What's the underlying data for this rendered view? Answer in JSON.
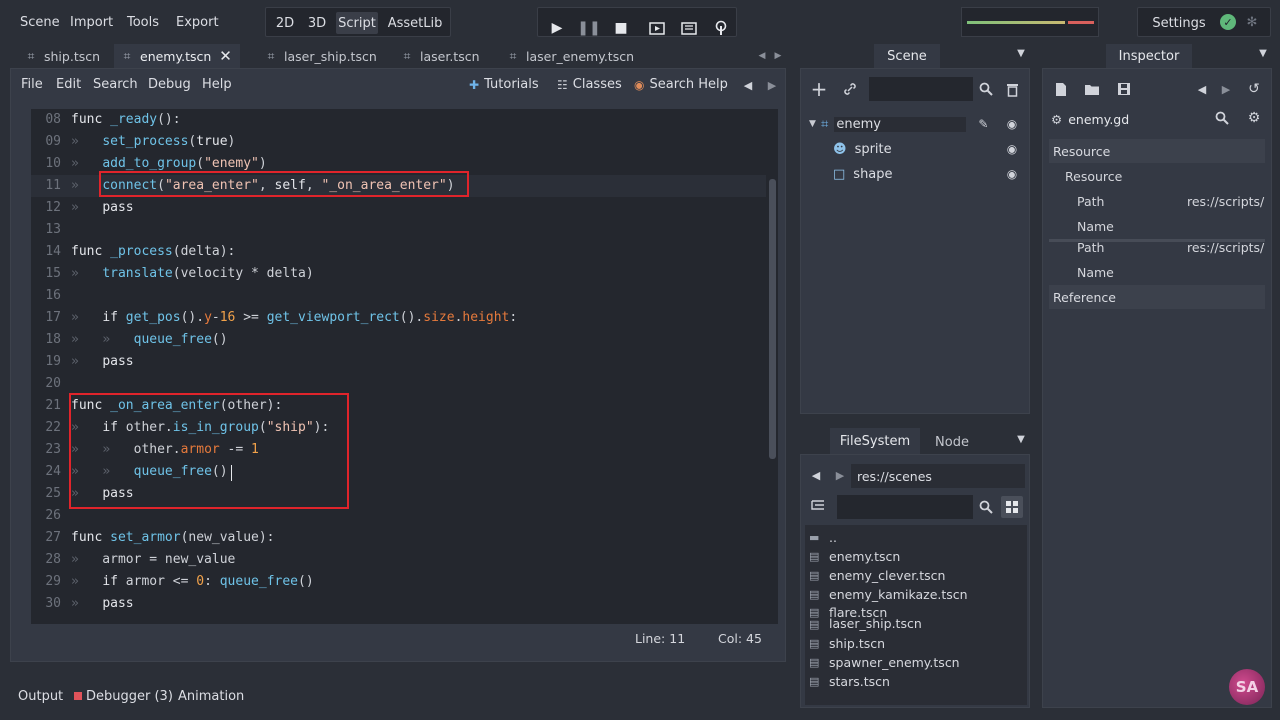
{
  "topbar": {
    "menus": [
      "Scene",
      "Import",
      "Tools",
      "Export"
    ],
    "modes": [
      "2D",
      "3D",
      "Script",
      "AssetLib"
    ],
    "active_mode": "Script",
    "settings_label": "Settings"
  },
  "tabs": [
    {
      "label": "ship.tscn"
    },
    {
      "label": "enemy.tscn",
      "active": true
    },
    {
      "label": "laser_ship.tscn"
    },
    {
      "label": "laser.tscn"
    },
    {
      "label": "laser_enemy.tscn"
    }
  ],
  "editor": {
    "menus": [
      "File",
      "Edit",
      "Search",
      "Debug",
      "Help"
    ],
    "tutorials_label": "Tutorials",
    "classes_label": "Classes",
    "search_help_label": "Search Help",
    "lines": [
      {
        "n": "08",
        "text": "func _ready():"
      },
      {
        "n": "09",
        "text": "  set_process(true)"
      },
      {
        "n": "10",
        "text": "  add_to_group(\"enemy\")"
      },
      {
        "n": "11",
        "text": "  connect(\"area_enter\", self, \"_on_area_enter\")"
      },
      {
        "n": "12",
        "text": "  pass"
      },
      {
        "n": "13",
        "text": ""
      },
      {
        "n": "14",
        "text": "func _process(delta):"
      },
      {
        "n": "15",
        "text": "  translate(velocity * delta)"
      },
      {
        "n": "16",
        "text": ""
      },
      {
        "n": "17",
        "text": "  if get_pos().y-16 >= get_viewport_rect().size.height:"
      },
      {
        "n": "18",
        "text": "    queue_free()"
      },
      {
        "n": "19",
        "text": "  pass"
      },
      {
        "n": "20",
        "text": ""
      },
      {
        "n": "21",
        "text": "func _on_area_enter(other):"
      },
      {
        "n": "22",
        "text": "  if other.is_in_group(\"ship\"):"
      },
      {
        "n": "23",
        "text": "    other.armor -= 1"
      },
      {
        "n": "24",
        "text": "    queue_free()"
      },
      {
        "n": "25",
        "text": "  pass"
      },
      {
        "n": "26",
        "text": ""
      },
      {
        "n": "27",
        "text": "func set_armor(new_value):"
      },
      {
        "n": "28",
        "text": "  armor = new_value"
      },
      {
        "n": "29",
        "text": "  if armor <= 0: queue_free()"
      },
      {
        "n": "30",
        "text": "  pass"
      }
    ],
    "status_line": "Line: 11",
    "status_col": "Col: 45"
  },
  "scene_dock": {
    "title": "Scene",
    "nodes": [
      {
        "label": "enemy"
      },
      {
        "label": "sprite"
      },
      {
        "label": "shape"
      }
    ]
  },
  "filesystem": {
    "tabs": [
      "FileSystem",
      "Node"
    ],
    "path": "res://scenes",
    "items": [
      "..",
      "enemy.tscn",
      "enemy_clever.tscn",
      "enemy_kamikaze.tscn",
      "flare.tscn",
      "laser_ship.tscn",
      "ship.tscn",
      "spawner_enemy.tscn",
      "stars.tscn"
    ]
  },
  "inspector": {
    "title": "Inspector",
    "resource_name": "enemy.gd",
    "section_resource": "Resource",
    "sub_resource": "Resource",
    "path_label": "Path",
    "path_value": "res://scripts/",
    "name_label": "Name",
    "path_label2": "Path",
    "path_value2": "res://scripts/",
    "name_label2": "Name",
    "section_reference": "Reference"
  },
  "bottom": {
    "output": "Output",
    "debugger": "Debugger (3)",
    "animation": "Animation"
  }
}
